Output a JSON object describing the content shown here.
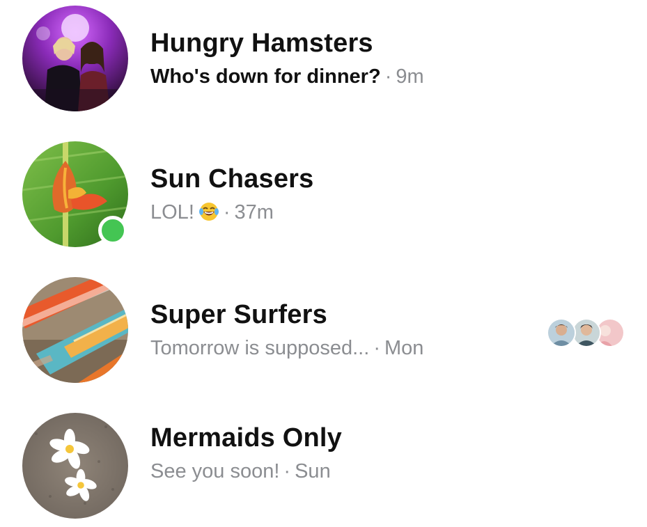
{
  "threads": [
    {
      "name": "Hungry Hamsters",
      "preview": "Who's down for dinner?",
      "separator": "·",
      "time": "9m",
      "unread": true,
      "online": false,
      "avatar_icon": "party-photo"
    },
    {
      "name": "Sun Chasers",
      "preview": "LOL!",
      "emoji_icon": "laughing-tears-emoji",
      "separator": "·",
      "time": "37m",
      "unread": false,
      "online": true,
      "avatar_icon": "flower-photo"
    },
    {
      "name": "Super Surfers",
      "preview": "Tomorrow is supposed...",
      "separator": "·",
      "time": "Mon",
      "unread": false,
      "online": false,
      "avatar_icon": "surfboards-photo",
      "seen_by_count": 3
    },
    {
      "name": "Mermaids Only",
      "preview": "See you soon!",
      "separator": "·",
      "time": "Sun",
      "unread": false,
      "online": false,
      "avatar_icon": "plumeria-sand-photo"
    }
  ],
  "colors": {
    "online": "#44c553",
    "muted_text": "#8b8d91",
    "primary_text": "#111111"
  }
}
